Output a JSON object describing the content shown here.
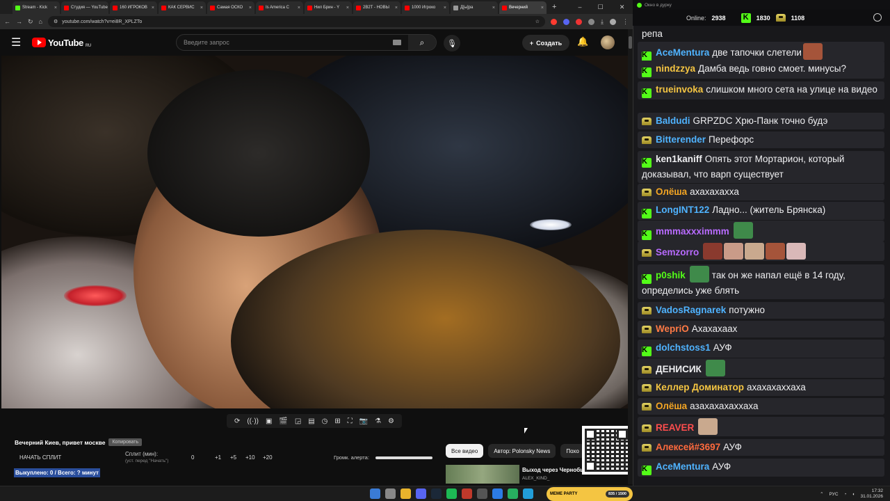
{
  "browser": {
    "tabs": [
      {
        "label": "Stream - Kick",
        "color": "#53fc18",
        "active": false
      },
      {
        "label": "Студия — YouTube",
        "color": "#ff0000",
        "active": false
      },
      {
        "label": "160 ИГРОКОВ",
        "color": "#ff0000",
        "active": false
      },
      {
        "label": "КАК СЕРВИС",
        "color": "#ff0000",
        "active": false
      },
      {
        "label": "Самая ОСКО",
        "color": "#ff0000",
        "active": false
      },
      {
        "label": "Is America C",
        "color": "#ff0000",
        "active": false
      },
      {
        "label": "Нил Брин - Y",
        "color": "#ff0000",
        "active": false
      },
      {
        "label": "2B2T - НОВЫ",
        "color": "#ff0000",
        "active": false
      },
      {
        "label": "1000 Игроко",
        "color": "#ff0000",
        "active": false
      },
      {
        "label": "Д[ы]ра",
        "color": "#999999",
        "active": false
      },
      {
        "label": "Вечерний",
        "color": "#ff0000",
        "active": true
      }
    ],
    "new_tab": "+",
    "url": "youtube.com/watch?v=ei8R_XPLZTo"
  },
  "youtube": {
    "logo_text": "YouTube",
    "region": "RU",
    "search_placeholder": "Введите запрос",
    "create_label": "Создать",
    "video_title": "Вечерний Киев, привет москве",
    "copy_label": "Копировать",
    "split_start": "НАЧАТЬ СПЛИТ",
    "split_label": "Сплит (мин):",
    "split_sub": "(уст. перед \"Начать\")",
    "split_values": [
      "0",
      "+1",
      "+5",
      "+10",
      "+20"
    ],
    "bought_line": "Выкуплено: 0 / Всего: ? минут",
    "alert_volume_label": "Громк. алерта:",
    "alert_volume": 1.0,
    "chips": [
      "Все видео",
      "Автор: Polonsky News",
      "Похо"
    ],
    "rec_title": "Выход через Чернобы",
    "rec_channel": "ALEX_KIND_"
  },
  "chat": {
    "window_title": "Окно в дурку",
    "online_label": "Online:",
    "online_count": "2938",
    "kick_count": "1830",
    "crown_count": "1108",
    "messages": [
      {
        "badge": "",
        "nick": "",
        "nick_color": "#efeff1",
        "text": "репа",
        "emotes": 0
      },
      {
        "badge": "kick",
        "nick": "AceMentura",
        "nick_color": "#4fb3ff",
        "text": "две тапочки слетели",
        "emotes": 1
      },
      {
        "badge": "kick",
        "nick": "nindzzya",
        "nick_color": "#f5c542",
        "text": "Дамба ведь говно смоет. минусы?",
        "emotes": 0
      },
      {
        "badge": "kick",
        "nick": "trueinvoka",
        "nick_color": "#f5c542",
        "text": "слишком много сета на улице на видео",
        "emotes": 0
      },
      {
        "badge": "crown",
        "nick": "Baldudi",
        "nick_color": "#4fb3ff",
        "text": "GRPZDC Хрю-Панк точно будэ",
        "emotes": 0
      },
      {
        "badge": "crown",
        "nick": "Bitterender",
        "nick_color": "#4fb3ff",
        "text": "Перефорс",
        "emotes": 0
      },
      {
        "badge": "kick",
        "nick": "ken1kaniff",
        "nick_color": "#efeff1",
        "text": "Опять этот Мортарион, который доказывал, что варп существует",
        "emotes": 0
      },
      {
        "badge": "crown",
        "nick": "Олёша",
        "nick_color": "#f5a623",
        "text": "ахахахахха",
        "emotes": 0
      },
      {
        "badge": "kick",
        "nick": "LongINT122",
        "nick_color": "#4fb3ff",
        "text": "Ладно... (житель Брянска)",
        "emotes": 0
      },
      {
        "badge": "kick",
        "nick": "mmmaxxximmm",
        "nick_color": "#b86bff",
        "text": "",
        "emotes": 1
      },
      {
        "badge": "crown",
        "nick": "Semzorro",
        "nick_color": "#b86bff",
        "text": "",
        "emotes": 5
      },
      {
        "badge": "kick",
        "nick": "p0shik",
        "nick_color": "#53fc18",
        "text": "так он же напал ещё в 14 году, определись уже блять",
        "emotes": 1
      },
      {
        "badge": "crown",
        "nick": "VadosRagnarek",
        "nick_color": "#4fb3ff",
        "text": "потужно",
        "emotes": 0
      },
      {
        "badge": "crown",
        "nick": "WepriO",
        "nick_color": "#ff7a45",
        "text": "Ахахахаах",
        "emotes": 0
      },
      {
        "badge": "kick",
        "nick": "dolchstoss1",
        "nick_color": "#4fb3ff",
        "text": "АУФ",
        "emotes": 0
      },
      {
        "badge": "crown",
        "nick": "ДЕНИСИК",
        "nick_color": "#efeff1",
        "text": "",
        "emotes": 1
      },
      {
        "badge": "crown",
        "nick": "Келлер Доминатор",
        "nick_color": "#f5c542",
        "text": "ахахахаххаха",
        "emotes": 0
      },
      {
        "badge": "crown",
        "nick": "Олёша",
        "nick_color": "#f5a623",
        "text": "азахахахаххаха",
        "emotes": 0
      },
      {
        "badge": "crown",
        "nick": "REAVER",
        "nick_color": "#ff4d4d",
        "text": "",
        "emotes": 1
      },
      {
        "badge": "crown",
        "nick": "Алексей#3697",
        "nick_color": "#ff6a3d",
        "text": "АУФ",
        "emotes": 0
      },
      {
        "badge": "kick",
        "nick": "AceMentura",
        "nick_color": "#4fb3ff",
        "text": "АУФ",
        "emotes": 0
      }
    ]
  },
  "taskbar": {
    "widget_title": "MEME PARTY",
    "widget_progress": "835 / 1500",
    "lang": "РУС",
    "time": "17:32",
    "date": "31.01.2026"
  }
}
